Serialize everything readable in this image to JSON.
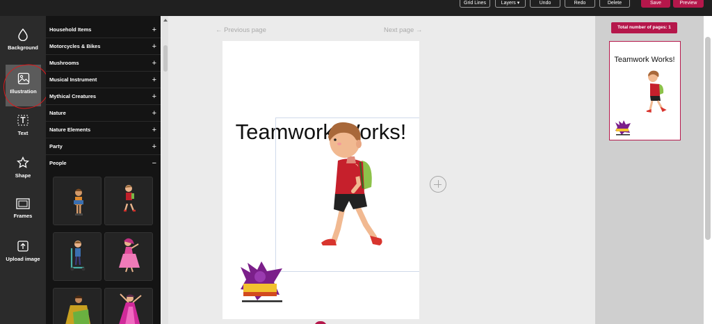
{
  "toolbar": {
    "grid_lines": "Grid Lines",
    "layers": "Layers ▾",
    "undo": "Undo",
    "redo": "Redo",
    "delete": "Delete",
    "save": "Save",
    "preview": "Preview"
  },
  "rail": {
    "items": [
      {
        "label": "Background",
        "icon": "droplet-icon"
      },
      {
        "label": "Illustration",
        "icon": "image-icon"
      },
      {
        "label": "Text",
        "icon": "text-icon"
      },
      {
        "label": "Shape",
        "icon": "star-icon"
      },
      {
        "label": "Frames",
        "icon": "frame-icon"
      },
      {
        "label": "Upload image",
        "icon": "upload-icon"
      }
    ]
  },
  "categories": [
    {
      "label": "Household Items",
      "toggle": "+"
    },
    {
      "label": "Motorcycles & Bikes",
      "toggle": "+"
    },
    {
      "label": "Mushrooms",
      "toggle": "+"
    },
    {
      "label": "Musical Instrument",
      "toggle": "+"
    },
    {
      "label": "Mythical Creatures",
      "toggle": "+"
    },
    {
      "label": "Nature",
      "toggle": "+"
    },
    {
      "label": "Nature Elements",
      "toggle": "+"
    },
    {
      "label": "Party",
      "toggle": "+"
    },
    {
      "label": "People",
      "toggle": "−"
    }
  ],
  "nav": {
    "previous": "← Previous page",
    "next": "Next page →"
  },
  "canvas": {
    "title": "Teamwork Works!"
  },
  "pages_panel": {
    "badge": "Total number of pages: 1",
    "thumb_title": "Teamwork Works!"
  },
  "colors": {
    "accent": "#b5174b",
    "rail_bg": "#2b2b2b",
    "panel_bg": "#141414"
  }
}
